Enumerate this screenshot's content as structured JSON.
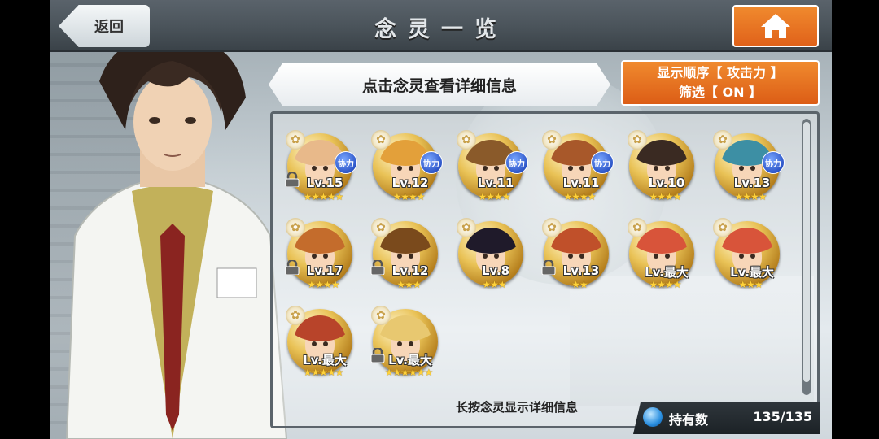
{
  "header": {
    "title": "念灵一览",
    "back_label": "返回"
  },
  "banner": {
    "text": "点击念灵查看详细信息"
  },
  "sort": {
    "line1": "显示顺序【 攻击力 】",
    "line2": "筛选【 ON 】"
  },
  "coop_label": "协力",
  "units": [
    {
      "level": "Lv.15",
      "stars": "★★★★★",
      "coop": true,
      "locked": true,
      "hair": "#e8b98a"
    },
    {
      "level": "Lv.12",
      "stars": "★★★★",
      "coop": true,
      "locked": false,
      "hair": "#e3a03a"
    },
    {
      "level": "Lv.11",
      "stars": "★★★★",
      "coop": true,
      "locked": false,
      "hair": "#8a5a2a"
    },
    {
      "level": "Lv.11",
      "stars": "★★★★",
      "coop": true,
      "locked": false,
      "hair": "#a8582a"
    },
    {
      "level": "Lv.10",
      "stars": "★★★★",
      "coop": false,
      "locked": false,
      "hair": "#3a2a22"
    },
    {
      "level": "Lv.13",
      "stars": "★★★★",
      "coop": true,
      "locked": false,
      "hair": "#3d8fa4"
    },
    {
      "level": "Lv.17",
      "stars": "★★★★",
      "coop": false,
      "locked": true,
      "hair": "#c46c2c"
    },
    {
      "level": "Lv.12",
      "stars": "★★★",
      "coop": false,
      "locked": true,
      "hair": "#7a4a1c"
    },
    {
      "level": "Lv.8",
      "stars": "★★★",
      "coop": false,
      "locked": false,
      "hair": "#1f1a2a"
    },
    {
      "level": "Lv.13",
      "stars": "★★",
      "coop": false,
      "locked": true,
      "hair": "#c0502a"
    },
    {
      "level": "Lv.最大",
      "stars": "★★★★",
      "coop": false,
      "locked": false,
      "hair": "#d8543a"
    },
    {
      "level": "Lv.最大",
      "stars": "★★★",
      "coop": false,
      "locked": false,
      "hair": "#d8543a"
    },
    {
      "level": "Lv.最大",
      "stars": "★★★★★",
      "coop": false,
      "locked": false,
      "hair": "#b8442a"
    },
    {
      "level": "Lv.最大",
      "stars": "★★★★★★",
      "coop": false,
      "locked": true,
      "hair": "#e8c870"
    }
  ],
  "footer": {
    "hint": "长按念灵显示详细信息",
    "owned_label": "持有数",
    "owned_value": "135/135"
  },
  "colors": {
    "accent_orange": "#e8721f",
    "header_dark": "#4a535a",
    "coop_blue": "#2d56c9"
  }
}
